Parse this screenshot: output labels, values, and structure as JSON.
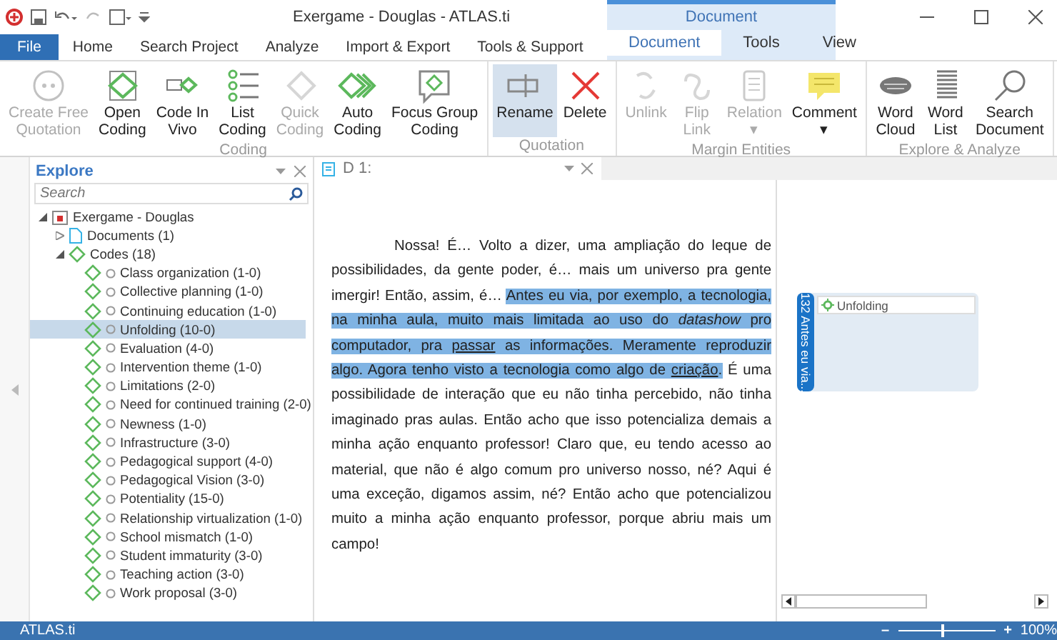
{
  "window": {
    "title": "Exergame - Douglas - ATLAS.ti"
  },
  "tabs": [
    {
      "label": "File",
      "selected": false,
      "kind": "file"
    },
    {
      "label": "Home",
      "selected": false,
      "kind": "plain"
    },
    {
      "label": "Search Project",
      "selected": false,
      "kind": "plain"
    },
    {
      "label": "Analyze",
      "selected": false,
      "kind": "plain"
    },
    {
      "label": "Import & Export",
      "selected": false,
      "kind": "plain"
    },
    {
      "label": "Tools & Support",
      "selected": false,
      "kind": "plain"
    }
  ],
  "context_tabs": {
    "label": "Document",
    "tabs": [
      {
        "label": "Document",
        "selected": true
      },
      {
        "label": "Tools",
        "selected": false
      },
      {
        "label": "View",
        "selected": false
      }
    ]
  },
  "ribbon": [
    {
      "label": "Coding",
      "buttons": [
        {
          "lines": [
            "Create Free",
            "Quotation"
          ],
          "disabled": true,
          "selected": false
        },
        {
          "lines": [
            "Open",
            "Coding"
          ],
          "disabled": false,
          "selected": false
        },
        {
          "lines": [
            "Code In",
            "Vivo"
          ],
          "disabled": false,
          "selected": false
        },
        {
          "lines": [
            "List",
            "Coding"
          ],
          "disabled": false,
          "selected": false
        },
        {
          "lines": [
            "Quick",
            "Coding"
          ],
          "disabled": true,
          "selected": false
        },
        {
          "lines": [
            "Auto",
            "Coding"
          ],
          "disabled": false,
          "selected": false
        },
        {
          "lines": [
            "Focus Group",
            "Coding"
          ],
          "disabled": false,
          "selected": false
        }
      ]
    },
    {
      "label": "Quotation",
      "buttons": [
        {
          "lines": [
            "Rename"
          ],
          "disabled": false,
          "selected": true
        },
        {
          "lines": [
            "Delete"
          ],
          "disabled": false,
          "selected": false
        }
      ]
    },
    {
      "label": "Margin Entities",
      "buttons": [
        {
          "lines": [
            "Unlink"
          ],
          "disabled": true,
          "selected": false
        },
        {
          "lines": [
            "Flip",
            "Link"
          ],
          "disabled": true,
          "selected": false
        },
        {
          "lines": [
            "Relation",
            "▾"
          ],
          "disabled": true,
          "selected": false
        },
        {
          "lines": [
            "Comment",
            "▾"
          ],
          "disabled": false,
          "selected": false
        }
      ]
    },
    {
      "label": "Explore & Analyze",
      "buttons": [
        {
          "lines": [
            "Word",
            "Cloud"
          ],
          "disabled": false,
          "selected": false
        },
        {
          "lines": [
            "Word",
            "List"
          ],
          "disabled": false,
          "selected": false
        },
        {
          "lines": [
            "Search",
            "Document"
          ],
          "disabled": false,
          "selected": false
        }
      ]
    }
  ],
  "explore": {
    "title": "Explore",
    "search": {
      "placeholder": "Search"
    },
    "tree": {
      "label": "Exergame - Douglas",
      "expanded": true,
      "children": [
        {
          "label": "Documents (1)",
          "kind": "documents",
          "expanded": false
        },
        {
          "label": "Codes (18)",
          "kind": "codes",
          "expanded": true,
          "children": [
            {
              "label": "Class organization (1-0)",
              "selected": false
            },
            {
              "label": "Collective planning (1-0)",
              "selected": false
            },
            {
              "label": "Continuing education (1-0)",
              "selected": false
            },
            {
              "label": "Unfolding (10-0)",
              "selected": true
            },
            {
              "label": "Evaluation (4-0)",
              "selected": false
            },
            {
              "label": "Intervention theme (1-0)",
              "selected": false
            },
            {
              "label": "Limitations (2-0)",
              "selected": false
            },
            {
              "label": "Need for continued training (2-0)",
              "selected": false
            },
            {
              "label": "Newness (1-0)",
              "selected": false
            },
            {
              "label": "Infrastructure (3-0)",
              "selected": false
            },
            {
              "label": "Pedagogical support (4-0)",
              "selected": false
            },
            {
              "label": "Pedagogical Vision (3-0)",
              "selected": false
            },
            {
              "label": "Potentiality (15-0)",
              "selected": false
            },
            {
              "label": "Relationship virtualization (1-0)",
              "selected": false
            },
            {
              "label": "School mismatch (1-0)",
              "selected": false
            },
            {
              "label": "Student immaturity (3-0)",
              "selected": false
            },
            {
              "label": "Teaching action (3-0)",
              "selected": false
            },
            {
              "label": "Work proposal (3-0)",
              "selected": false
            }
          ]
        }
      ]
    }
  },
  "document": {
    "tab": "D 1:",
    "segments": [
      {
        "text": "Nossa! É… Volto a dizer, uma ampliação do leque de possibilidades, da gente poder, é… mais um universo pra gente imergir! Então, assim, é… ",
        "highlighted": false,
        "underlined": false
      },
      {
        "text": "Antes eu via, por exemplo, a tecnologia, na minha aula, muito mais limitada ao uso do *datashow* pro computador, pra ",
        "highlighted": true,
        "underlined": false
      },
      {
        "text": "passar",
        "highlighted": true,
        "underlined": true
      },
      {
        "text": " as informações. Meramente reproduzir algo. Agora tenho visto a tecnologia como algo de ",
        "highlighted": true,
        "underlined": false
      },
      {
        "text": "criação",
        "highlighted": true,
        "underlined": true
      },
      {
        "text": ".",
        "highlighted": true,
        "underlined": false
      },
      {
        "text": " É uma possibilidade de interação que eu não tinha percebido, não tinha imaginado pras aulas. Então acho que isso potencializa demais a minha ação enquanto professor! Claro que, eu tendo acesso ao material, que não é algo comum pro universo nosso, né? Aqui é uma exceção, digamos assim, né? Então acho que potencializou muito a minha ação enquanto professor, porque abriu mais um campo!",
        "highlighted": false,
        "underlined": false
      }
    ]
  },
  "margin": {
    "quotation": "132 Antes eu via...",
    "code": "Unfolding"
  },
  "status_bar": {
    "text": "ATLAS.ti",
    "zoom": {
      "minus": "–",
      "plus": "+",
      "level": 0.45,
      "reading": "100%"
    }
  }
}
